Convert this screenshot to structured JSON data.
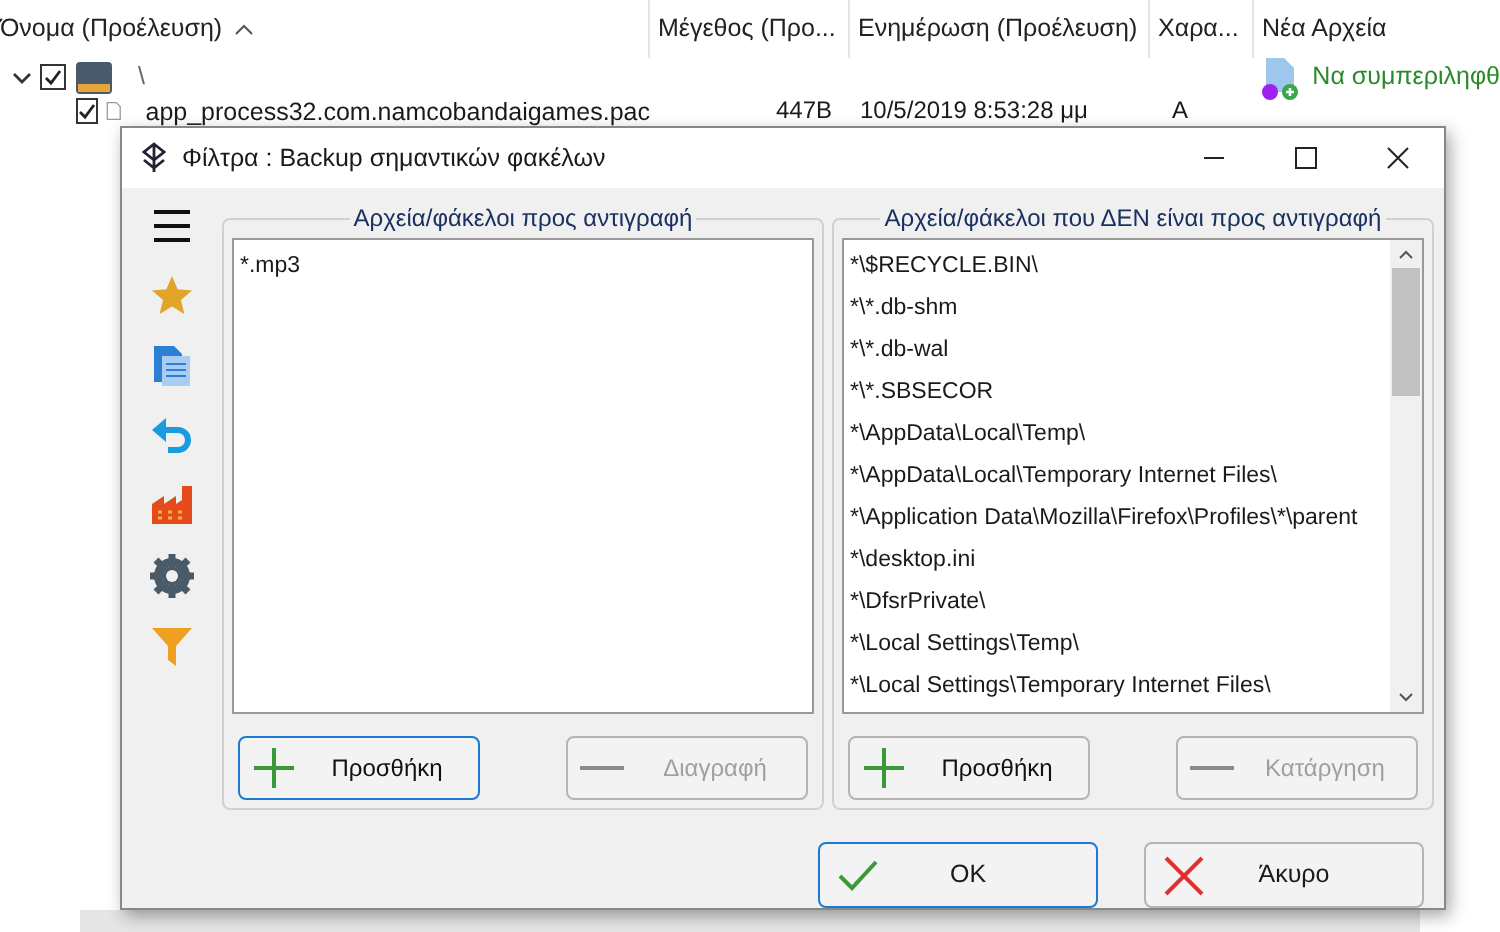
{
  "explorer": {
    "columns": [
      {
        "label": "Όνομα (Προέλευση)",
        "sorted": true
      },
      {
        "label": "Μέγεθος (Προ..."
      },
      {
        "label": "Ενημέρωση (Προέλευση)"
      },
      {
        "label": "Χαρα..."
      },
      {
        "label": "Νέα Αρχεία"
      }
    ],
    "rows": [
      {
        "expanded": true,
        "checked": true,
        "kind": "drive",
        "name": "\\",
        "status": "Να συμπεριληφθ"
      },
      {
        "checked": true,
        "kind": "file",
        "name": "app_process32.com.namcobandaigames.pac",
        "size": "447B",
        "modified": "10/5/2019 8:53:28 μμ",
        "attr": "A"
      }
    ]
  },
  "dialog": {
    "title": "Φίλτρα : Backup σημαντικών φακέλων",
    "sidebar": [
      {
        "kind": "menu"
      },
      {
        "kind": "star"
      },
      {
        "kind": "docs"
      },
      {
        "kind": "undo"
      },
      {
        "kind": "factory"
      },
      {
        "kind": "gear"
      },
      {
        "kind": "filter"
      }
    ],
    "include": {
      "title": "Αρχεία/φάκελοι προς αντιγραφή",
      "items": [
        "*.mp3"
      ],
      "buttons": [
        {
          "label": "Προσθήκη",
          "kind": "add",
          "disabled": false,
          "focused": true
        },
        {
          "label": "Διαγραφή",
          "kind": "remove",
          "disabled": true,
          "focused": false
        }
      ]
    },
    "exclude": {
      "title": "Αρχεία/φάκελοι που ΔΕΝ είναι προς αντιγραφή",
      "items": [
        "*\\$RECYCLE.BIN\\",
        "*\\*.db-shm",
        "*\\*.db-wal",
        "*\\*.SBSECOR",
        "*\\AppData\\Local\\Temp\\",
        "*\\AppData\\Local\\Temporary Internet Files\\",
        "*\\Application Data\\Mozilla\\Firefox\\Profiles\\*\\parent",
        "*\\desktop.ini",
        "*\\DfsrPrivate\\",
        "*\\Local Settings\\Temp\\",
        "*\\Local Settings\\Temporary Internet Files\\"
      ],
      "buttons": [
        {
          "label": "Προσθήκη",
          "kind": "add",
          "disabled": false,
          "focused": false
        },
        {
          "label": "Κατάργηση",
          "kind": "remove",
          "disabled": true,
          "focused": false
        }
      ]
    },
    "actions": [
      {
        "label": "OK",
        "kind": "ok",
        "focused": true
      },
      {
        "label": "Άκυρο",
        "kind": "cancel",
        "focused": false
      }
    ]
  }
}
